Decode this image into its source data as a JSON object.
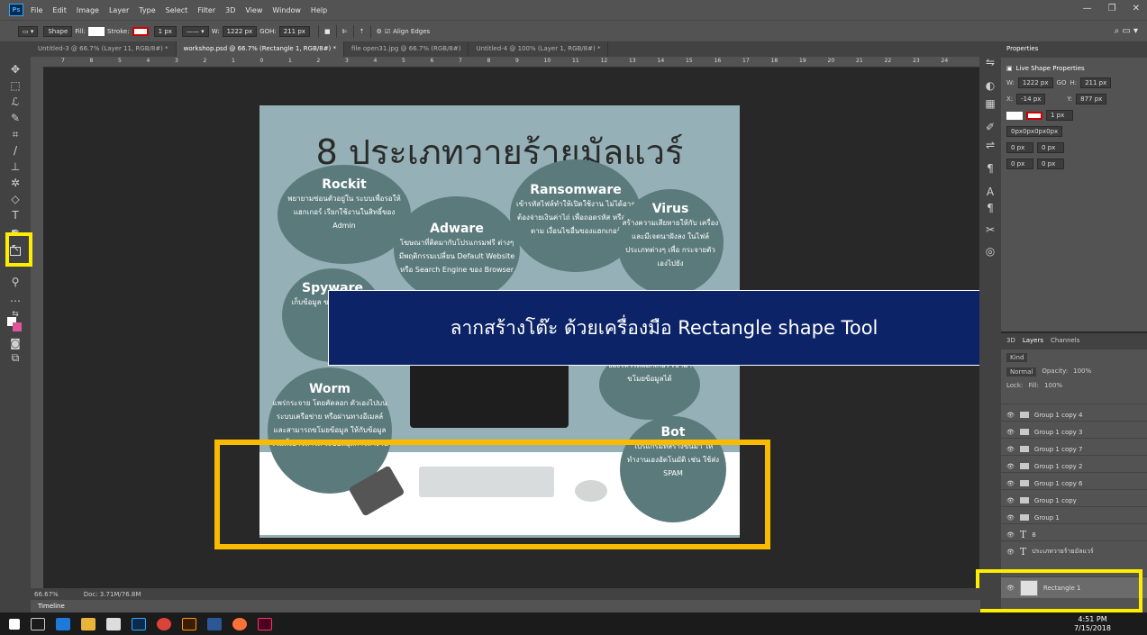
{
  "menu": {
    "logo": "Ps",
    "items": [
      "File",
      "Edit",
      "Image",
      "Layer",
      "Type",
      "Select",
      "Filter",
      "3D",
      "View",
      "Window",
      "Help"
    ]
  },
  "options": {
    "mode": "Shape",
    "fill_label": "Fill:",
    "stroke_label": "Stroke:",
    "stroke_size": "1 px",
    "w_label": "W:",
    "w_value": "1222 px",
    "link": "GO",
    "h_label": "H:",
    "h_value": "211 px",
    "align_edges": "Align Edges"
  },
  "tabs": [
    "Untitled-3 @ 66.7% (Layer 11, RGB/8#) *",
    "workshop.psd @ 66.7% (Rectangle 1, RGB/8#) *",
    "file open31.jpg @ 66.7% (RGB/8#)",
    "Untitled-4 @ 100% (Layer 1, RGB/8#) *"
  ],
  "ruler": [
    "7",
    "8",
    "5",
    "4",
    "3",
    "2",
    "1",
    "0",
    "1",
    "2",
    "3",
    "4",
    "5",
    "6",
    "7",
    "8",
    "9",
    "10",
    "11",
    "12",
    "13",
    "14",
    "15",
    "16",
    "17",
    "18",
    "19",
    "20",
    "21",
    "22",
    "23",
    "24"
  ],
  "artwork": {
    "title": "8 ประเภทวายร้ายมัลแวร์",
    "circles": [
      {
        "name": "rockit",
        "heading": "Rockit",
        "text": "พยายามซ่อนตัวอยู่ใน ระบบเพื่อรอให้แฮกเกอร์ เรียกใช้งานในสิทธิ์ของ Admin"
      },
      {
        "name": "adware",
        "heading": "Adware",
        "text": "โฆษณาที่ติดมากับโปรแกรมฟรี ต่างๆ มีพฤติกรรมเปลี่ยน Default Website หรือ Search Engine ของ Browser"
      },
      {
        "name": "ransomware",
        "heading": "Ransomware",
        "text": "เข้ารหัสไฟล์ทำให้เปิดใช้งาน ไม่ได้อาจต้องจ่ายเงินค่าไถ่ เพื่อถอดรหัส หรือทำตาม เงื่อนไขอื่นของแฮกเกอร์"
      },
      {
        "name": "virus",
        "heading": "Virus",
        "text": "สร้างความเสียหายให้กับ เครื่องและมีเจตนาฝังลง ในไฟล์ประเภทต่างๆ เพื่อ กระจายตัวเองไปยัง"
      },
      {
        "name": "spyware",
        "heading": "Spyware",
        "text": "เก็บข้อมูล ของเครื่อง แฮกเ"
      },
      {
        "name": "worm",
        "heading": "Worm",
        "text": "แพร่กระจาย โดยคัดลอก ตัวเองไปบนระบบเครือข่าย หรือผ่านทางอีเมลล์ และสามารถขโมยข้อมูล ให้กับข้อมูลรวมทั้งอาจทำให้ ระบบหยุดการทำงาน"
      },
      {
        "name": "trojan",
        "heading": "",
        "text": "ช่องโหว่ให้แฮกเกอร์ เข้ามาขโมยข้อมูลได้"
      },
      {
        "name": "bot",
        "heading": "Bot",
        "text": "โปรแกรมที่สร้างขึ้นมา ให้ทำงานเองอัตโนมัติ เช่น ใช้ส่ง SPAM"
      }
    ]
  },
  "caption": "ลากสร้างโต๊ะ ด้วยเครื่องมือ Rectangle shape Tool",
  "properties": {
    "tab": "Properties",
    "title": "Live Shape Properties",
    "w_label": "W:",
    "w": "1222 px",
    "go": "GO",
    "h_label": "H:",
    "h": "211 px",
    "x_label": "X:",
    "x": "-14 px",
    "y_label": "Y:",
    "y": "877 px",
    "stroke": "1 px",
    "radius": "0px0px0px0px",
    "r1": "0 px",
    "r2": "0 px",
    "r3": "0 px",
    "r4": "0 px"
  },
  "layers": {
    "tabs": [
      "3D",
      "Layers",
      "Channels"
    ],
    "kind": "Kind",
    "blend": "Normal",
    "opacity_label": "Opacity:",
    "opacity": "100%",
    "lock_label": "Lock:",
    "fill_label": "Fill:",
    "fill": "100%",
    "items": [
      "Group 1 copy 4",
      "Group 1 copy 3",
      "Group 1 copy 7",
      "Group 1 copy 2",
      "Group 1 copy 6",
      "Group 1 copy",
      "Group 1",
      "8",
      "ประเภทวายร้ายมัลแวร์",
      "Rectangle 1"
    ]
  },
  "status": {
    "zoom": "66.67%",
    "doc": "Doc: 3.71M/76.8M"
  },
  "timeline": "Timeline",
  "clock": {
    "time": "4:51 PM",
    "date": "7/15/2018"
  }
}
